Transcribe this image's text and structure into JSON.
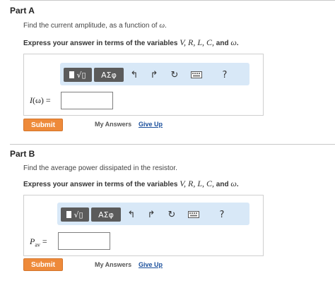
{
  "part_a": {
    "heading": "Part A",
    "prompt_text": "Find the current amplitude, as a function of ",
    "prompt_var": "ω",
    "prompt_end": ".",
    "instruction_text": "Express your answer in terms of the variables ",
    "instruction_vars": "V, R, L, C,",
    "instruction_and": " and ",
    "instruction_last_var": "ω",
    "instruction_end": ".",
    "var_label_main": "I",
    "var_label_rest": "(ω) =",
    "submit_label": "Submit",
    "my_answers_label": "My Answers",
    "give_up_label": "Give Up"
  },
  "part_b": {
    "heading": "Part B",
    "prompt_text": "Find the average power dissipated in the resistor.",
    "instruction_text": "Express your answer in terms of the variables ",
    "instruction_vars": "V, R, L, C,",
    "instruction_and": " and ",
    "instruction_last_var": "ω",
    "instruction_end": ".",
    "var_label_main": "P",
    "var_label_sub": "av",
    "var_label_eq": " =",
    "submit_label": "Submit",
    "my_answers_label": "My Answers",
    "give_up_label": "Give Up"
  },
  "toolbar": {
    "templates_symbol": "√▯",
    "greek_label": "ΑΣφ",
    "undo_icon": "undo-icon",
    "redo_icon": "redo-icon",
    "reset_icon": "reset-icon",
    "keyboard_icon": "keyboard-icon",
    "help_label": "?"
  },
  "colors": {
    "submit_bg": "#ee8a3a",
    "toolbar_bg": "#d8e8f7",
    "toolbar_button_bg": "#5b5b5b",
    "link": "#1a4f9c"
  }
}
